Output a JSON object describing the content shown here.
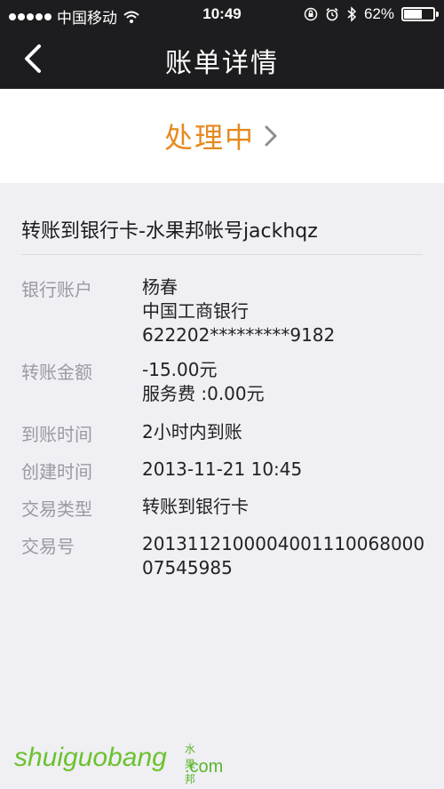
{
  "status_bar": {
    "carrier": "中国移动",
    "time": "10:49",
    "battery": "62%",
    "battery_level": 0.62
  },
  "nav": {
    "title": "账单详情"
  },
  "status": {
    "label": "处理中"
  },
  "detail": {
    "title": "转账到银行卡-水果邦帐号jackhqz",
    "rows": [
      {
        "label": "银行账户",
        "lines": [
          "杨春",
          "中国工商银行",
          "622202*********9182"
        ]
      },
      {
        "label": "转账金额",
        "lines": [
          "-15.00元",
          "服务费 :0.00元"
        ]
      },
      {
        "label": "到账时间",
        "lines": [
          "2小时内到账"
        ]
      },
      {
        "label": "创建时间",
        "lines": [
          "2013-11-21 10:45"
        ]
      },
      {
        "label": "交易类型",
        "lines": [
          "转账到银行卡"
        ]
      },
      {
        "label": "交易号",
        "lines": [
          "2013112100004001110068000",
          "07545985"
        ]
      }
    ]
  },
  "watermark": {
    "main": "shuiguobang",
    "cn": "水果邦",
    "com": ".com"
  },
  "icons": [
    "signal-dots-icon",
    "wifi-icon",
    "lock-rotation-icon",
    "alarm-icon",
    "bluetooth-icon",
    "battery-icon",
    "back-chevron-icon",
    "chevron-right-icon"
  ]
}
